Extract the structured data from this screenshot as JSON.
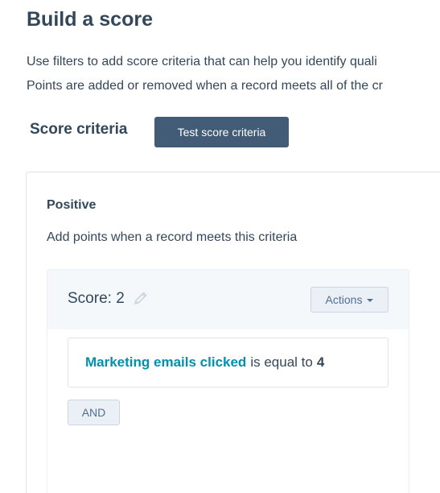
{
  "page": {
    "title": "Build a score",
    "description_line1": "Use filters to add score criteria that can help you identify quali",
    "description_line2": "Points are added or removed when a record meets all of the cr"
  },
  "score_criteria": {
    "title": "Score criteria",
    "test_button_label": "Test score criteria"
  },
  "positive_group": {
    "title": "Positive",
    "description": "Add points when a record meets this criteria",
    "score_label": "Score: 2",
    "actions_label": "Actions",
    "filter": {
      "property": "Marketing emails clicked",
      "operator": "is equal to",
      "value": "4"
    },
    "and_label": "AND"
  },
  "colors": {
    "primary_button": "#425b76",
    "link_teal": "#0091ae",
    "text": "#33475b",
    "secondary_button_bg": "#eaf0f6"
  },
  "icons": {
    "edit": "pencil-icon",
    "dropdown": "caret-down-icon"
  }
}
